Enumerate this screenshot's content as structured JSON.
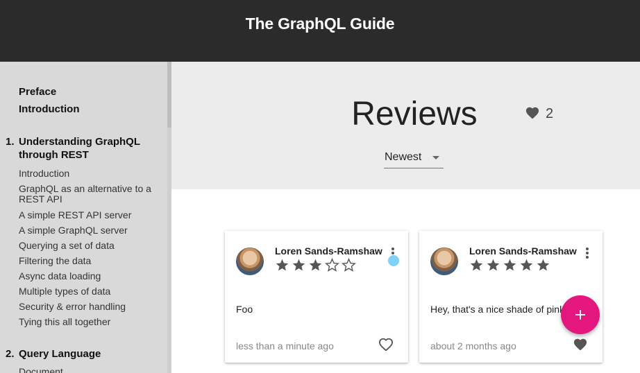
{
  "app": {
    "title": "The GraphQL Guide"
  },
  "sidebar": {
    "top_links": [
      "Preface",
      "Introduction"
    ],
    "chapters": [
      {
        "number": "1.",
        "title": "Understanding GraphQL through REST",
        "sections": [
          "Introduction",
          "GraphQL as an alternative to a REST API",
          "A simple REST API server",
          "A simple GraphQL server",
          "Querying a set of data",
          "Filtering the data",
          "Async data loading",
          "Multiple types of data",
          "Security & error handling",
          "Tying this all together"
        ]
      },
      {
        "number": "2.",
        "title": "Query Language",
        "sections": [
          "Document"
        ]
      }
    ]
  },
  "reviews": {
    "title": "Reviews",
    "favorite_count": "2",
    "sort": {
      "selected": "Newest"
    },
    "cards": [
      {
        "author": "Loren Sands-Ramshaw",
        "rating": 3,
        "text": "Foo",
        "time": "less than a minute ago",
        "favorited": false
      },
      {
        "author": "Loren Sands-Ramshaw",
        "rating": 5,
        "text": "Hey, that's a nice shade of pink",
        "time": "about 2 months ago",
        "favorited": true
      }
    ]
  },
  "icons": {
    "fab": "plus-icon",
    "favorite": "heart-icon",
    "menu": "more-vert-icon",
    "star": "star-icon"
  },
  "colors": {
    "accent": "#e4177f",
    "ripple": "#7fd3f7",
    "header": "#2b2b2b"
  }
}
